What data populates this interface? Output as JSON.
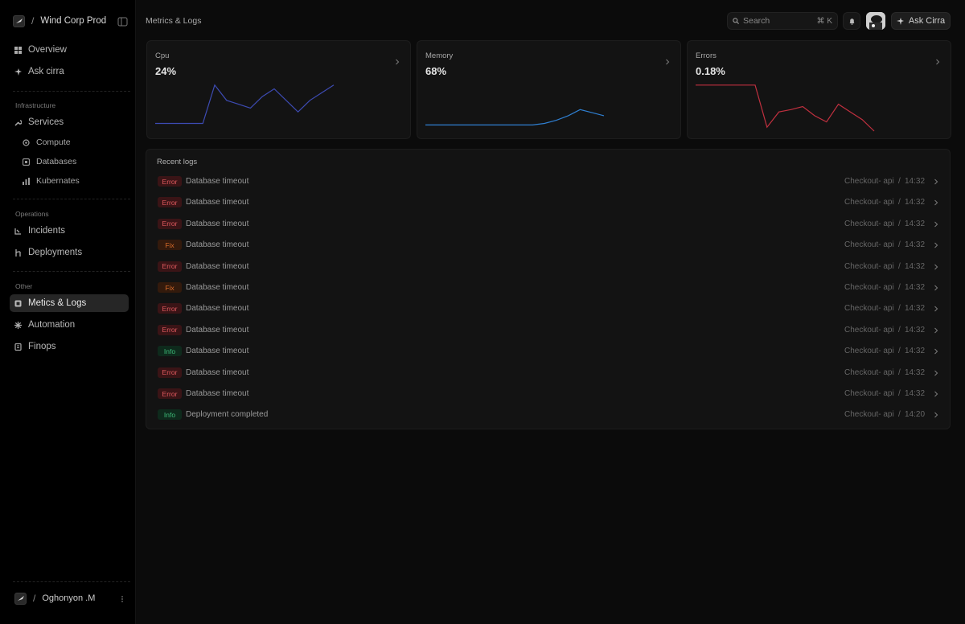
{
  "sidebar": {
    "org_name": "Wind Corp Prod",
    "separator": "/",
    "items_top": [
      {
        "label": "Overview",
        "icon": "grid-icon"
      },
      {
        "label": "Ask cirra",
        "icon": "sparkle-icon"
      }
    ],
    "sections": [
      {
        "label": "Infrastructure"
      },
      {
        "label": "Operations"
      },
      {
        "label": "Other"
      }
    ],
    "infrastructure": {
      "services": {
        "label": "Services",
        "icon": "wrench-icon"
      },
      "children": [
        {
          "label": "Compute",
          "icon": "chip-icon"
        },
        {
          "label": "Databases",
          "icon": "database-icon"
        },
        {
          "label": "Kubernates",
          "icon": "bar-chart-icon"
        }
      ]
    },
    "operations": [
      {
        "label": "Incidents",
        "icon": "incident-icon"
      },
      {
        "label": "Deployments",
        "icon": "branch-icon"
      }
    ],
    "other": [
      {
        "label": "Metics & Logs",
        "icon": "logs-icon",
        "active": true
      },
      {
        "label": "Automation",
        "icon": "automation-icon"
      },
      {
        "label": "Finops",
        "icon": "document-icon"
      }
    ],
    "user": {
      "name": "Oghonyon .M"
    }
  },
  "header": {
    "title": "Metrics & Logs",
    "search_placeholder": "Search",
    "search_shortcut": "⌘ K",
    "ask_button": "Ask Cirra"
  },
  "colors": {
    "cpu": "#3d4bb3",
    "memory": "#2f7fd1",
    "errors": "#c0303f",
    "active_bg": "#262626"
  },
  "chart_data": [
    {
      "type": "line",
      "title": "Cpu",
      "value": "24%",
      "y": [
        10,
        10,
        10,
        10,
        10,
        60,
        40,
        35,
        30,
        45,
        55,
        40,
        25,
        40,
        50,
        60
      ],
      "ylim": [
        0,
        65
      ]
    },
    {
      "type": "line",
      "title": "Memory",
      "value": "68%",
      "y": [
        8,
        8,
        8,
        8,
        8,
        8,
        8,
        8,
        8,
        8,
        10,
        14,
        20,
        28,
        24,
        20
      ],
      "ylim": [
        0,
        65
      ]
    },
    {
      "type": "line",
      "title": "Errors",
      "value": "0.18%",
      "y": [
        60,
        60,
        60,
        60,
        60,
        60,
        5,
        25,
        28,
        32,
        20,
        12,
        35,
        25,
        15,
        0
      ],
      "ylim": [
        0,
        65
      ]
    }
  ],
  "logs": {
    "title": "Recent logs",
    "separator": "/",
    "rows": [
      {
        "level": "Error",
        "kind": "error",
        "message": "Database timeout",
        "service": "Checkout- api",
        "time": "14:32"
      },
      {
        "level": "Error",
        "kind": "error",
        "message": "Database timeout",
        "service": "Checkout- api",
        "time": "14:32"
      },
      {
        "level": "Error",
        "kind": "error",
        "message": "Database timeout",
        "service": "Checkout- api",
        "time": "14:32"
      },
      {
        "level": "Fix",
        "kind": "fix",
        "message": "Database timeout",
        "service": "Checkout- api",
        "time": "14:32"
      },
      {
        "level": "Error",
        "kind": "error",
        "message": "Database timeout",
        "service": "Checkout- api",
        "time": "14:32"
      },
      {
        "level": "Fix",
        "kind": "fix",
        "message": "Database timeout",
        "service": "Checkout- api",
        "time": "14:32"
      },
      {
        "level": "Error",
        "kind": "error",
        "message": "Database timeout",
        "service": "Checkout- api",
        "time": "14:32"
      },
      {
        "level": "Error",
        "kind": "error",
        "message": "Database timeout",
        "service": "Checkout- api",
        "time": "14:32"
      },
      {
        "level": "Info",
        "kind": "info",
        "message": "Database timeout",
        "service": "Checkout- api",
        "time": "14:32"
      },
      {
        "level": "Error",
        "kind": "error",
        "message": "Database timeout",
        "service": "Checkout- api",
        "time": "14:32"
      },
      {
        "level": "Error",
        "kind": "error",
        "message": "Database timeout",
        "service": "Checkout- api",
        "time": "14:32"
      },
      {
        "level": "Info",
        "kind": "info",
        "message": "Deployment completed",
        "service": "Checkout- api",
        "time": "14:20"
      }
    ]
  }
}
